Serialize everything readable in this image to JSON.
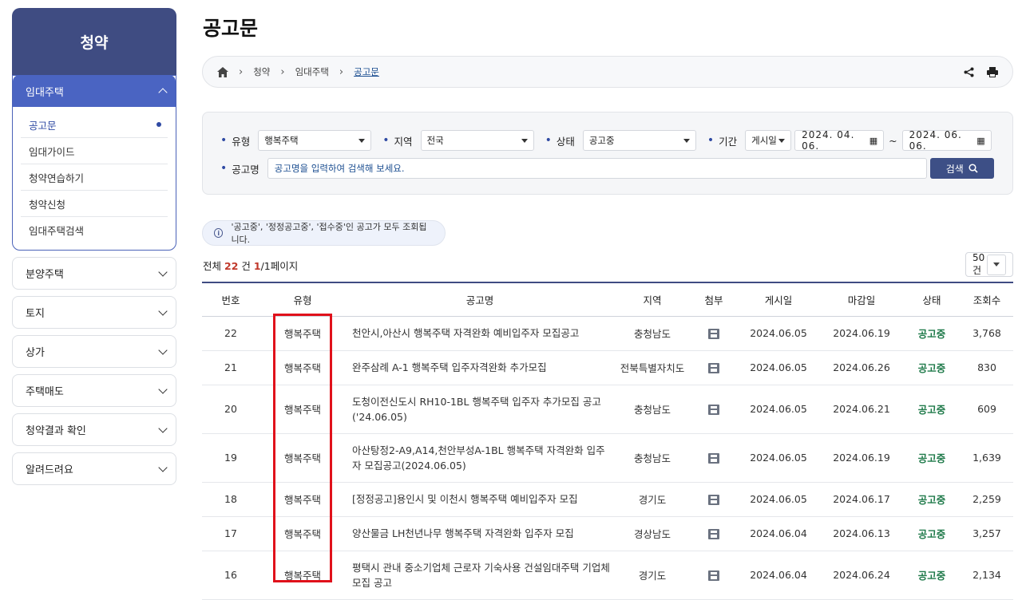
{
  "sidebar": {
    "title": "청약",
    "open_section": {
      "label": "임대주택",
      "items": [
        {
          "label": "공고문",
          "active": true
        },
        {
          "label": "임대가이드"
        },
        {
          "label": "청약연습하기"
        },
        {
          "label": "청약신청"
        },
        {
          "label": "임대주택검색"
        }
      ]
    },
    "sections": [
      "분양주택",
      "토지",
      "상가",
      "주택매도",
      "청약결과 확인",
      "알려드려요"
    ]
  },
  "page_title": "공고문",
  "breadcrumb": [
    "청약",
    "임대주택",
    "공고문"
  ],
  "filter": {
    "type_label": "유형",
    "type_value": "행복주택",
    "region_label": "지역",
    "region_value": "전국",
    "status_label": "상태",
    "status_value": "공고중",
    "period_label": "기간",
    "period_type": "게시일",
    "date_from": "2024. 04. 06.",
    "date_sep": "~",
    "date_to": "2024. 06. 06.",
    "name_label": "공고명",
    "name_placeholder": "공고명을 입력하여 검색해 보세요.",
    "search_button": "검색"
  },
  "notice": "'공고중', '정정공고중', '접수중'인 공고가 모두 조회됩니다.",
  "count": {
    "prefix": "전체",
    "total": "22",
    "unit": "건",
    "page": "1",
    "pages": "/1페이지"
  },
  "page_size": "50건",
  "table": {
    "headers": [
      "번호",
      "유형",
      "공고명",
      "지역",
      "첨부",
      "게시일",
      "마감일",
      "상태",
      "조회수"
    ],
    "rows": [
      {
        "no": "22",
        "type": "행복주택",
        "name": "천안시,아산시 행복주택 자격완화 예비입주자 모집공고",
        "region": "충청남도",
        "posted": "2024.06.05",
        "deadline": "2024.06.19",
        "status": "공고중",
        "views": "3,768"
      },
      {
        "no": "21",
        "type": "행복주택",
        "name": "완주삼례 A-1 행복주택 입주자격완화 추가모집",
        "region": "전북특별자치도",
        "posted": "2024.06.05",
        "deadline": "2024.06.26",
        "status": "공고중",
        "views": "830"
      },
      {
        "no": "20",
        "type": "행복주택",
        "name": "도청이전신도시 RH10-1BL 행복주택 입주자 추가모집 공고 ('24.06.05)",
        "region": "충청남도",
        "posted": "2024.06.05",
        "deadline": "2024.06.21",
        "status": "공고중",
        "views": "609"
      },
      {
        "no": "19",
        "type": "행복주택",
        "name": "아산탕정2-A9,A14,천안부성A-1BL 행복주택 자격완화 입주자 모집공고(2024.06.05)",
        "region": "충청남도",
        "posted": "2024.06.05",
        "deadline": "2024.06.19",
        "status": "공고중",
        "views": "1,639"
      },
      {
        "no": "18",
        "type": "행복주택",
        "name": "[정정공고]용인시 및 이천시 행복주택 예비입주자 모집",
        "region": "경기도",
        "posted": "2024.06.05",
        "deadline": "2024.06.17",
        "status": "공고중",
        "views": "2,259"
      },
      {
        "no": "17",
        "type": "행복주택",
        "name": "양산물금 LH천년나무 행복주택 자격완화 입주자 모집",
        "region": "경상남도",
        "posted": "2024.06.04",
        "deadline": "2024.06.13",
        "status": "공고중",
        "views": "3,257"
      },
      {
        "no": "16",
        "type": "행복주택",
        "name": "평택시 관내 중소기업체 근로자 기숙사용 건설임대주택 기업체 모집 공고",
        "region": "경기도",
        "posted": "2024.06.04",
        "deadline": "2024.06.24",
        "status": "공고중",
        "views": "2,134"
      }
    ]
  }
}
